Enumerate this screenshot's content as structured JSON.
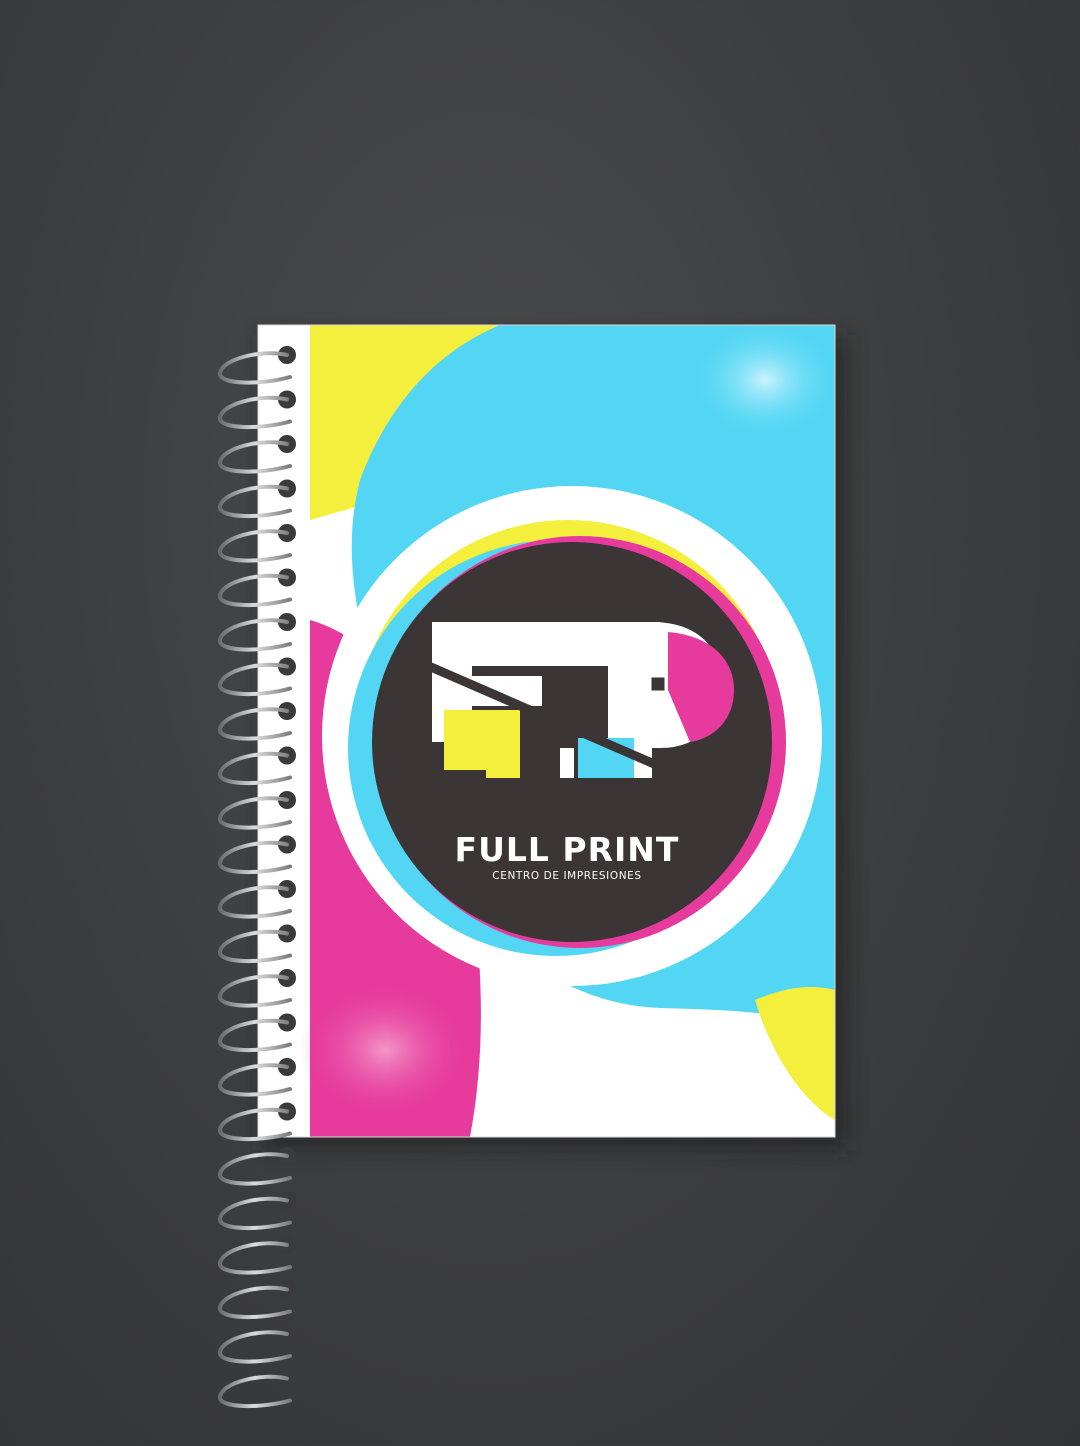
{
  "brand": {
    "name": "FULL PRINT",
    "tagline": "CENTRO DE IMPRESIONES",
    "monogram": "FP"
  },
  "colors": {
    "background": "#3e3f41",
    "cyan": "#52d6f4",
    "yellow": "#f4ee3c",
    "magenta": "#e63a9c",
    "logo_dark": "#3b3536",
    "cover_white": "#ffffff"
  },
  "icons": {
    "binding": "spiral-binding",
    "logo": "fp-monogram-icon"
  }
}
